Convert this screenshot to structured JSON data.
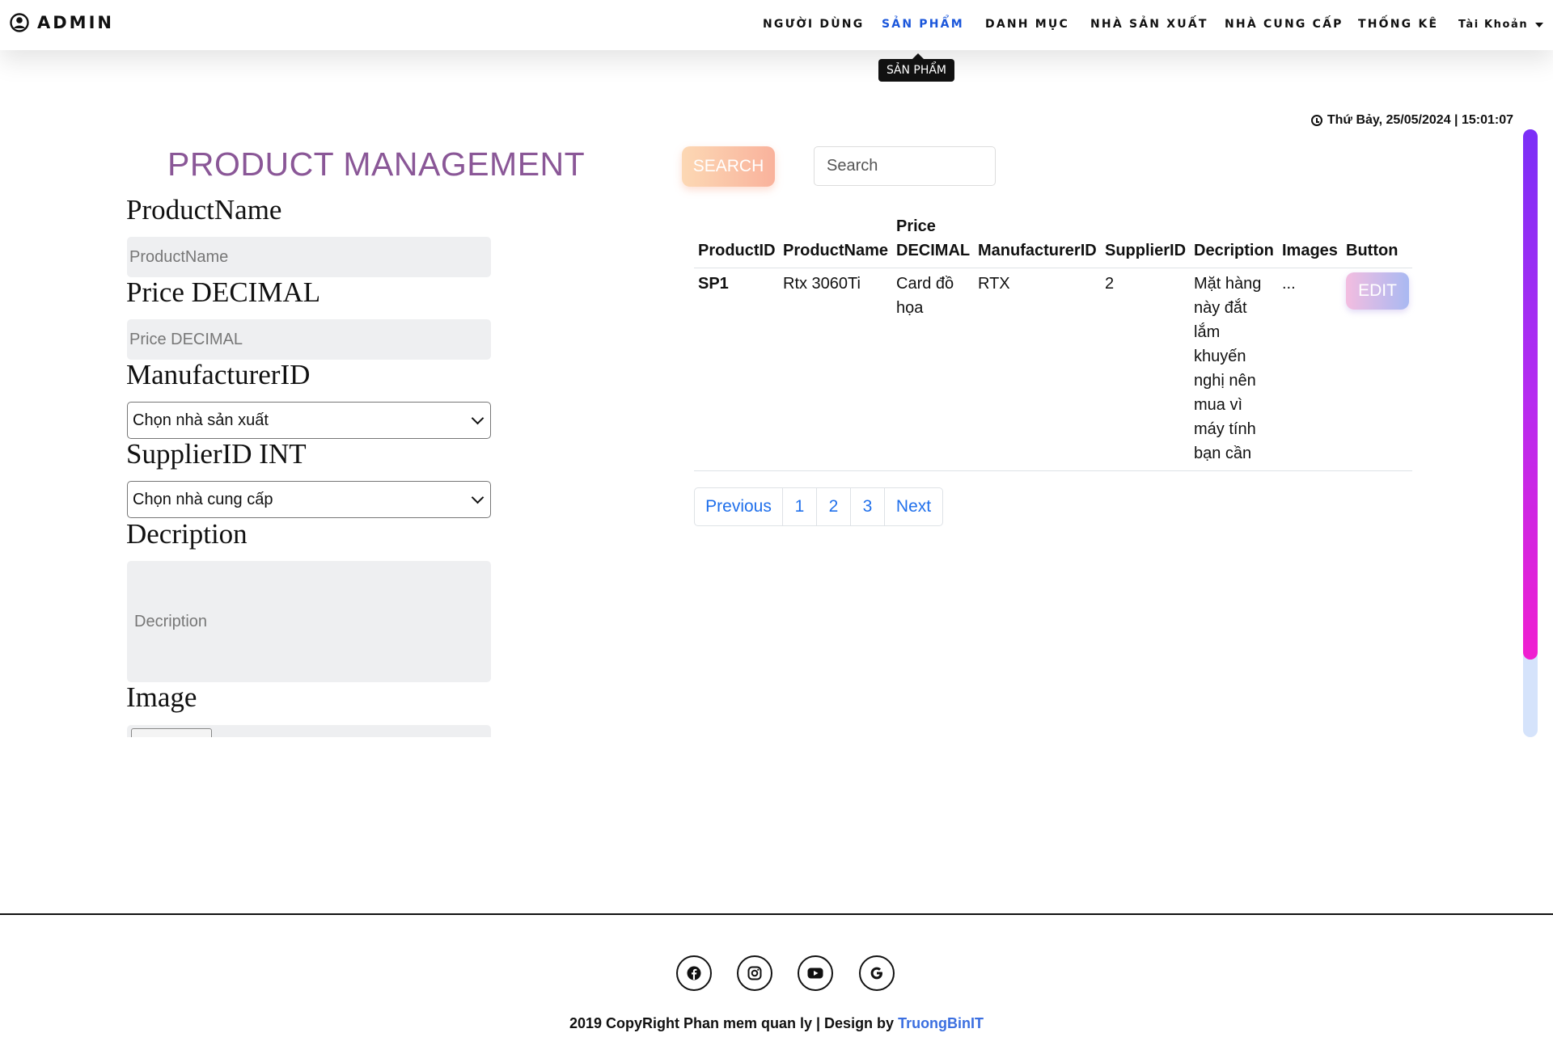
{
  "navbar": {
    "brand": "ADMIN",
    "items": [
      {
        "label": "NGƯỜI DÙNG"
      },
      {
        "label": "SẢN PHẨM"
      },
      {
        "label": "DANH MỤC"
      },
      {
        "label": "NHÀ SẢN XUẤT"
      },
      {
        "label": "NHÀ CUNG CẤP"
      },
      {
        "label": "THỐNG KÊ"
      }
    ],
    "account_label": "Tài Khoản",
    "tooltip": "SẢN PHẨM",
    "active_color": "#1a56db"
  },
  "clock": {
    "text": "Thứ Bảy, 25/05/2024 | 15:01:07"
  },
  "form": {
    "title": "PRODUCT MANAGEMENT",
    "product_name_label": "ProductName",
    "product_name_placeholder": "ProductName",
    "price_label": "Price DECIMAL",
    "price_placeholder": "Price DECIMAL",
    "manufacturer_label": "ManufacturerID",
    "manufacturer_select": "Chọn nhà sản xuất",
    "supplier_label": "SupplierID INT",
    "supplier_select": "Chọn nhà cung cấp",
    "description_label": "Decription",
    "description_placeholder": "Decription",
    "image_label": "Image"
  },
  "search": {
    "button_label": "SEARCH",
    "placeholder": "Search"
  },
  "table": {
    "headers": [
      "ProductID",
      "ProductName",
      "Price",
      "DECIMAL",
      "ManufacturerID",
      "SupplierID",
      "Decription",
      "Images",
      "Button"
    ],
    "rows": [
      {
        "product_id": "SP1",
        "product_name": "Rtx 3060Ti",
        "price_lines": [
          "Card đồ",
          "họa"
        ],
        "manufacturer_id": "RTX",
        "supplier_id": "2",
        "description_lines": [
          "Mặt hàng",
          "này đắt",
          "lắm",
          "khuyến",
          "nghị nên",
          "mua vì",
          "máy tính",
          "bạn cần"
        ],
        "images": "...",
        "button_label": "EDIT"
      }
    ]
  },
  "pagination": [
    "Previous",
    "1",
    "2",
    "3",
    "Next"
  ],
  "footer": {
    "social": [
      "facebook-icon",
      "instagram-icon",
      "youtube-icon",
      "google-icon"
    ],
    "copyright_text": "2019 CopyRight Phan mem quan ly | Design by ",
    "designer": "TruongBinIT"
  }
}
